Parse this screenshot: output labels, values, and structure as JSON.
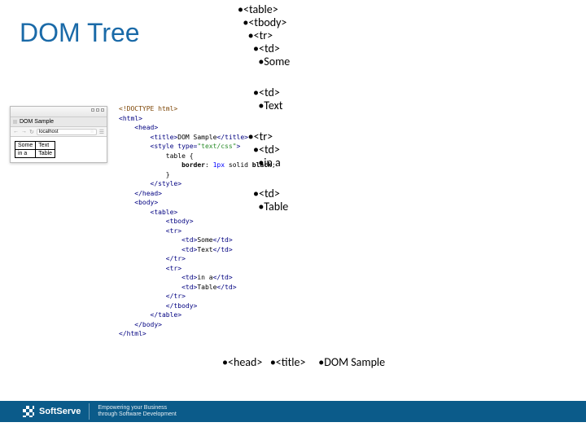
{
  "title": "DOM Tree",
  "browser": {
    "tab_title": "DOM Sample",
    "url": "localhost",
    "table": [
      [
        "Some",
        "Text"
      ],
      [
        "in a",
        "Table"
      ]
    ]
  },
  "code": {
    "doctype": "<!DOCTYPE html>",
    "html_open": "<html>",
    "head_open": "<head>",
    "title_open": "<title>",
    "title_text": "DOM Sample",
    "title_close": "</title>",
    "style_open": "<style ",
    "type_attr": "type=",
    "type_val": "\"text/css\"",
    "style_open_end": ">",
    "sel": "table {",
    "rule_key": "border",
    "rule_colon": ": ",
    "rule_px": "1px ",
    "rule_solid": "solid ",
    "rule_color": "black",
    "rule_semi": ";",
    "sel_close": "}",
    "style_close": "</style>",
    "head_close": "</head>",
    "body_open": "<body>",
    "table_open": "<table>",
    "tbody_open": "<tbody>",
    "tr_open": "<tr>",
    "td_open": "<td>",
    "td_close": "</td>",
    "cell1": "Some",
    "cell2": "Text",
    "cell3": "in a",
    "cell4": "Table",
    "tr_close": "</tr>",
    "tbody_close": "</tbody>",
    "table_close": "</table>",
    "body_close": "</body>",
    "html_close": "</html>"
  },
  "tree": {
    "table": "<table>",
    "tbody": "<tbody>",
    "tr": "<tr>",
    "td": "<td>",
    "some": "Some",
    "text": "Text",
    "ina": "in a",
    "tbl": "Table",
    "head": "<head>",
    "title": "<title>",
    "domsample": "DOM Sample"
  },
  "footer": {
    "brand": "SoftServe",
    "tag1": "Empowering your Business",
    "tag2": "through Software Development"
  }
}
